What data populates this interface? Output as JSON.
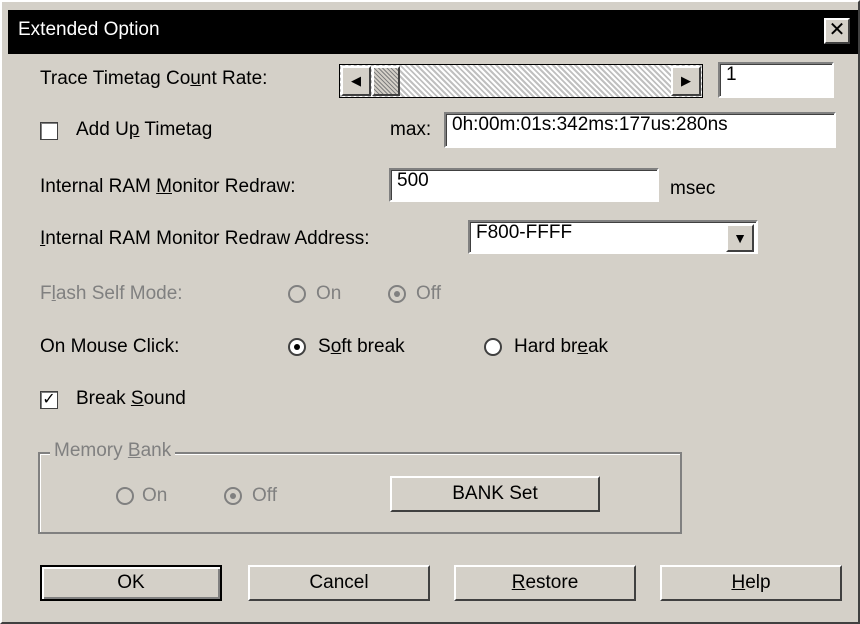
{
  "window": {
    "title": "Extended Option",
    "close_glyph": "✕"
  },
  "trace": {
    "label_pre": "Trace Timetag Co",
    "label_u": "u",
    "label_post": "nt Rate:",
    "left_arrow": "◀",
    "right_arrow": "▶",
    "rate_value": "1"
  },
  "add_up": {
    "checked": false,
    "label_pre": "Add U",
    "label_u": "p",
    "label_post": " Timetag",
    "max_label": "max:",
    "max_value": "0h:00m:01s:342ms:177us:280ns"
  },
  "redraw": {
    "label_pre": "Internal RAM ",
    "label_u": "M",
    "label_post": "onitor Redraw:",
    "value": "500",
    "unit": "msec"
  },
  "redraw_address": {
    "label_pre": "",
    "label_u": "I",
    "label_post": "nternal RAM Monitor Redraw Address:",
    "value": "F800-FFFF",
    "arrow": "▼"
  },
  "flash_self": {
    "label_pre": "F",
    "label_u": "l",
    "label_post": "ash Self Mode:",
    "on_label": "On",
    "off_label": "Off",
    "selected": "Off"
  },
  "mouse_click": {
    "label": "On Mouse Click:",
    "soft_pre": "S",
    "soft_u": "o",
    "soft_post": "ft break",
    "hard_pre": "Hard br",
    "hard_u": "e",
    "hard_post": "ak",
    "selected": "Soft break"
  },
  "break_sound": {
    "checked": true,
    "check_glyph": "✓",
    "label_pre": "Break ",
    "label_u": "S",
    "label_post": "ound"
  },
  "memory_bank": {
    "title_pre": "Memory ",
    "title_u": "B",
    "title_post": "ank",
    "on_label": "On",
    "off_label": "Off",
    "selected": "Off",
    "bank_set_label": "BANK Set"
  },
  "buttons": {
    "ok": "OK",
    "cancel": "Cancel",
    "restore_u": "R",
    "restore_post": "estore",
    "help_u": "H",
    "help_post": "elp"
  }
}
